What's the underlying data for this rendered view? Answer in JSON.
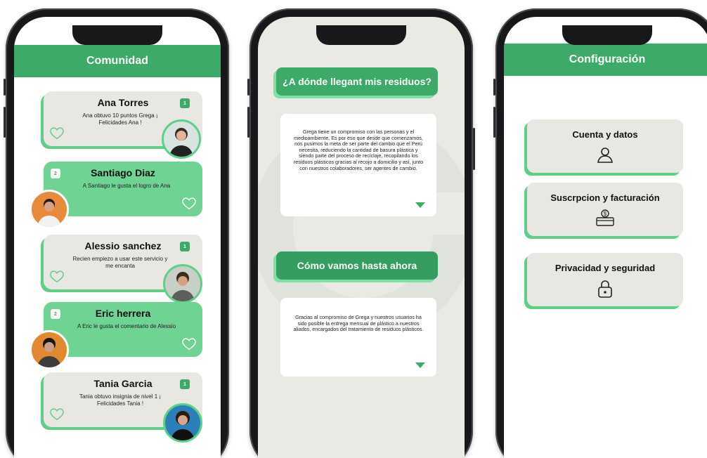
{
  "community": {
    "title": "Comunidad",
    "cards": [
      {
        "name": "Ana Torres",
        "message": "Ana obtuvo 10 puntos Grega ¡ Felicidades Ana !",
        "badge": "1"
      },
      {
        "name": "Santiago Diaz",
        "message": "A Santiago le gusta el logro de Ana",
        "badge": "2"
      },
      {
        "name": "Alessio sanchez",
        "message": "Recien empiezo a usar este servicio y me encanta",
        "badge": "1"
      },
      {
        "name": "Eric herrera",
        "message": "A Eric le gusta el comentario de Alessio",
        "badge": "2"
      },
      {
        "name": "Tania Garcia",
        "message": "Tania obtuvo insignia de nivel 1 ¡ Felicidades Tania !",
        "badge": "1"
      }
    ]
  },
  "residues": {
    "question": "¿A dónde llegant mis residuos?",
    "paragraph1": "Grega tiene un compromiso con las personas y el medioambiente. Es por eso que desde que comenzamos, nos pusimos la meta de ser parte del cambio que el Perú necesita, reduciendo la cantidad de basura plástica y siendo parte del proceso de reciclaje, recopilando los residuos plásticos gracias al recojo a domicilio y así, junto con nuestros colaboradores, ser agentes de cambio.",
    "progress_title": "Cómo vamos hasta ahora",
    "paragraph2": "Gracias al compromiso de Grega y nuestros usuarios ha sido posible la entrega mensual de plástico a nuestros aliados, encargados del tratamiento de residuos plásticos."
  },
  "settings": {
    "title": "Configuración",
    "options": [
      {
        "label": "Cuenta y datos",
        "icon": "user-icon"
      },
      {
        "label": "Suscrpcion y facturación",
        "icon": "payment-icon"
      },
      {
        "label": "Privacidad y seguridad",
        "icon": "lock-icon"
      }
    ]
  },
  "colors": {
    "accent": "#3daa6a",
    "light_accent": "#6fd393",
    "card_gray": "#e8e7e2",
    "beige": "#ebe9e4"
  }
}
